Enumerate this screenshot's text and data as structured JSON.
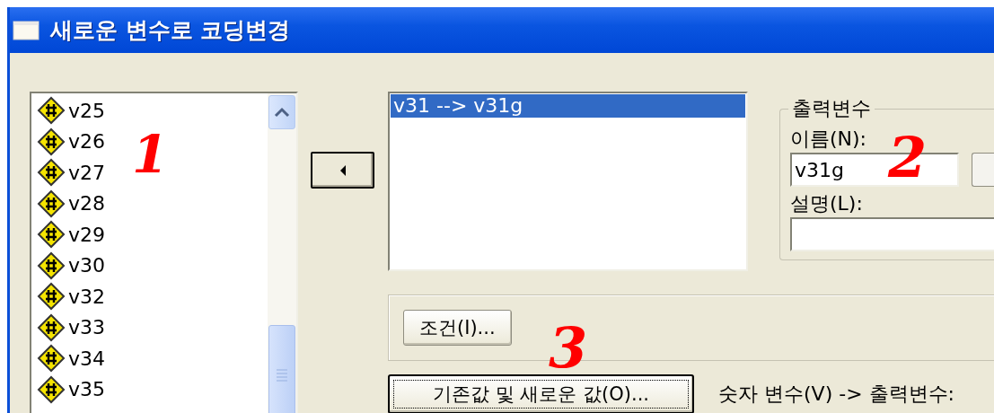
{
  "window": {
    "title": "새로운 변수로 코딩변경"
  },
  "variables": [
    {
      "name": "v25"
    },
    {
      "name": "v26"
    },
    {
      "name": "v27"
    },
    {
      "name": "v28"
    },
    {
      "name": "v29"
    },
    {
      "name": "v30"
    },
    {
      "name": "v32"
    },
    {
      "name": "v33"
    },
    {
      "name": "v34"
    },
    {
      "name": "v35"
    }
  ],
  "mappings": [
    {
      "text": "v31 --> v31g",
      "selected": true
    }
  ],
  "output_variable": {
    "title": "출력변수",
    "name_label": "이름(N):",
    "name_value": "v31g",
    "label_label": "설명(L):"
  },
  "condition_button": "조건(I)...",
  "old_new_button": {
    "label": "기존값 및 새로운 값(O)...",
    "focused": true
  },
  "mapping_caption": "숫자 변수(V) -> 출력변수:",
  "annotations": [
    {
      "text": "1"
    },
    {
      "text": "2"
    },
    {
      "text": "3"
    }
  ]
}
